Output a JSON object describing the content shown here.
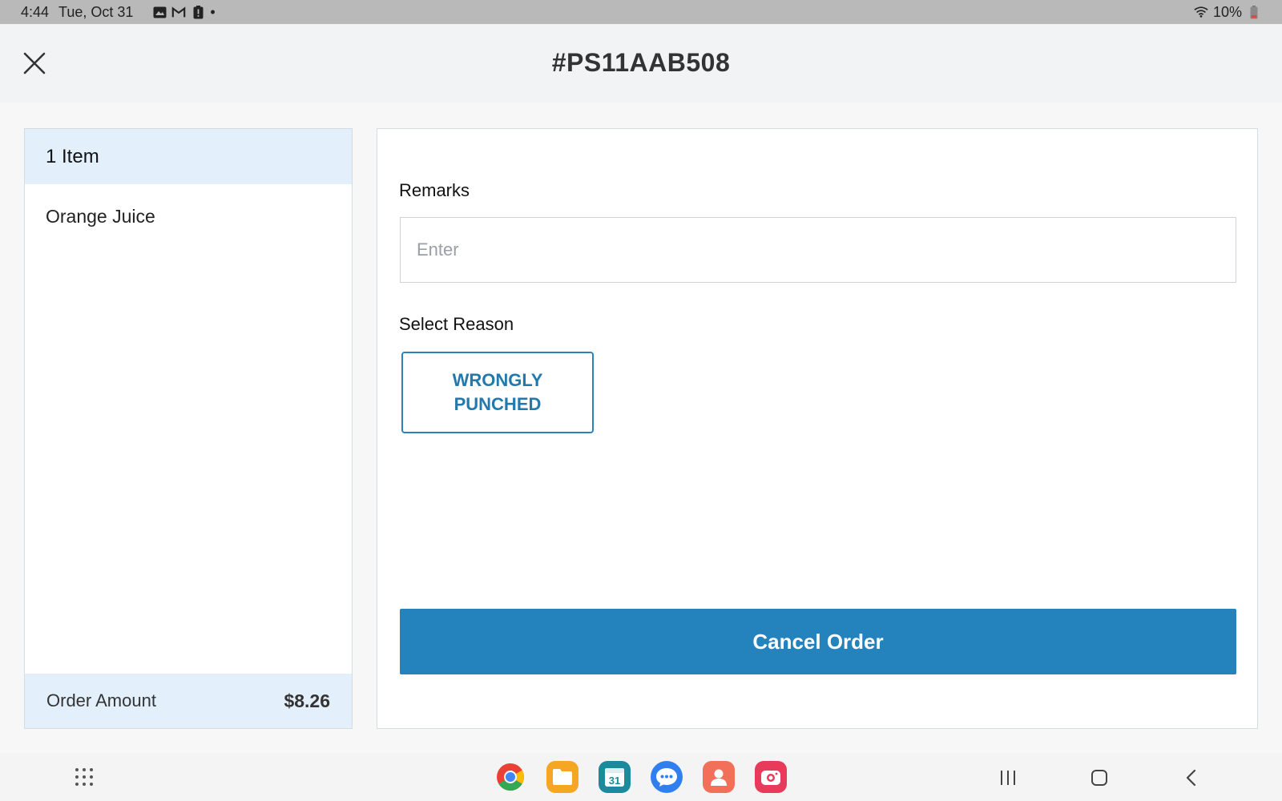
{
  "status_bar": {
    "time": "4:44",
    "date": "Tue, Oct 31",
    "icons": [
      "gallery-icon",
      "gmail-icon",
      "alert-icon"
    ],
    "dot": "•",
    "battery": "10%"
  },
  "header": {
    "title": "#PS11AAB508",
    "close_icon": "close-icon"
  },
  "order_summary": {
    "item_count": "1 Item",
    "items": [
      {
        "name": "Orange Juice"
      }
    ],
    "amount_label": "Order Amount",
    "amount_value": "$8.26"
  },
  "cancel_form": {
    "remarks_label": "Remarks",
    "remarks_value": "",
    "remarks_placeholder": "Enter",
    "reason_label": "Select Reason",
    "reasons": [
      {
        "label": "WRONGLY\nPUNCHED"
      }
    ],
    "submit_label": "Cancel Order"
  },
  "colors": {
    "accent": "#2482bd",
    "highlight_bg": "#e3f0fb",
    "status_bar_bg": "#b9b9b9"
  },
  "nav_bar": {
    "dock_apps": [
      {
        "name": "chrome-icon",
        "color": "#ffffff"
      },
      {
        "name": "files-icon",
        "color": "#f5a623"
      },
      {
        "name": "calendar-icon",
        "color": "#1a8a9c",
        "text": "31"
      },
      {
        "name": "messages-icon",
        "color": "#2f7ff0"
      },
      {
        "name": "contacts-icon",
        "color": "#f2705a"
      },
      {
        "name": "camera-icon",
        "color": "#e83a5a"
      }
    ],
    "buttons": [
      "recents-icon",
      "home-icon",
      "back-icon"
    ]
  }
}
